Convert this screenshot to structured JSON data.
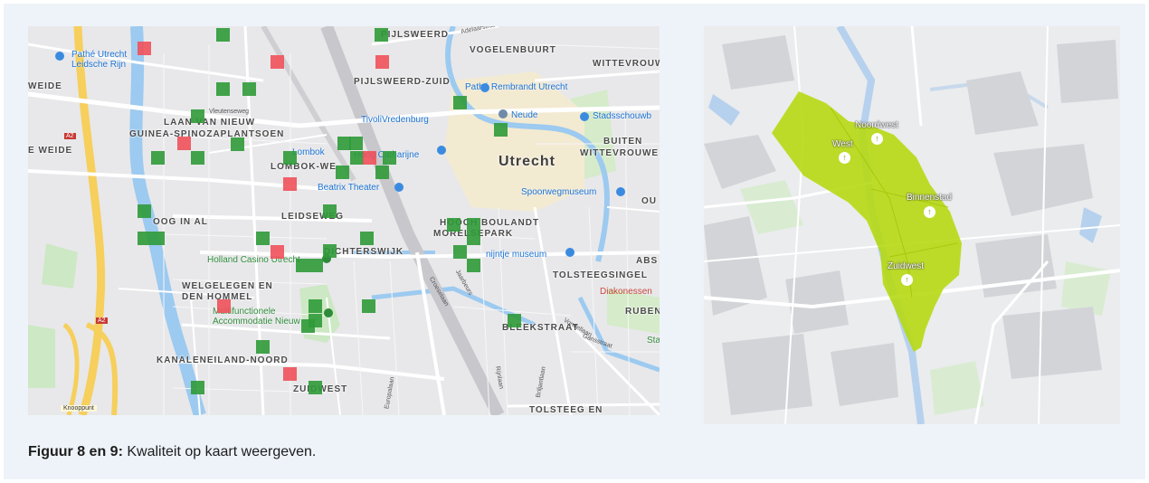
{
  "left_map": {
    "districts": [
      "PIJLSWEERD",
      "VOGELENBUURT",
      "WITTEVROUW",
      "PIJLSWEERD-ZUID",
      "WEIDE",
      "LAAN VAN NIEUW",
      "GUINEA-SPINOZAPLANTSOEN",
      "LOMBOK-WE",
      "E WEIDE",
      "BUITEN",
      "WITTEVROUWE",
      "OOG IN AL",
      "LEIDSEWEG",
      "HOOCH BOULANDT",
      "MORELSEPARK",
      "DICHTERSWIJK",
      "ABS",
      "TOLSTEEGSINGEL",
      "WELGELEGEN EN",
      "DEN HOMMEL",
      "RUBEN",
      "KANALENEILAND-NOORD",
      "BLEEKSTRAAT",
      "ZUIDWEST",
      "TOLSTEEG EN",
      "OU"
    ],
    "city": "Utrecht",
    "pois_blue": [
      "Pathé Utrecht",
      "Leidsche Rijn",
      "Pathé Rembrandt Utrecht",
      "TivoliVredenburg",
      "Neude",
      "Stadsschouwb",
      "Lombok",
      "Hoog Catharijne",
      "Beatrix Theater",
      "Spoorwegmuseum",
      "nijntje museum"
    ],
    "pois_green": [
      "Holland Casino Utrecht",
      "Multifunctionele",
      "Accommodatie Nieuw",
      "Sta"
    ],
    "pois_red": [
      "Diakonessen"
    ],
    "streets": [
      "Adelaarstraat",
      "Vleutenseweg",
      "Croeselaan",
      "Jaarbeurs",
      "Vondellaan",
      "Rijnlaan",
      "Briljantlaan",
      "Europalaan",
      "Gansstraat"
    ],
    "highway": "A2",
    "junction": "Knooppunt"
  },
  "right_map": {
    "labels": [
      "Noordwest",
      "West",
      "Binnenstad",
      "Zuidwest"
    ],
    "area_color": "#b5d80e"
  },
  "caption": {
    "bold": "Figuur 8 en 9:",
    "text": " Kwaliteit op kaart weergeven."
  }
}
